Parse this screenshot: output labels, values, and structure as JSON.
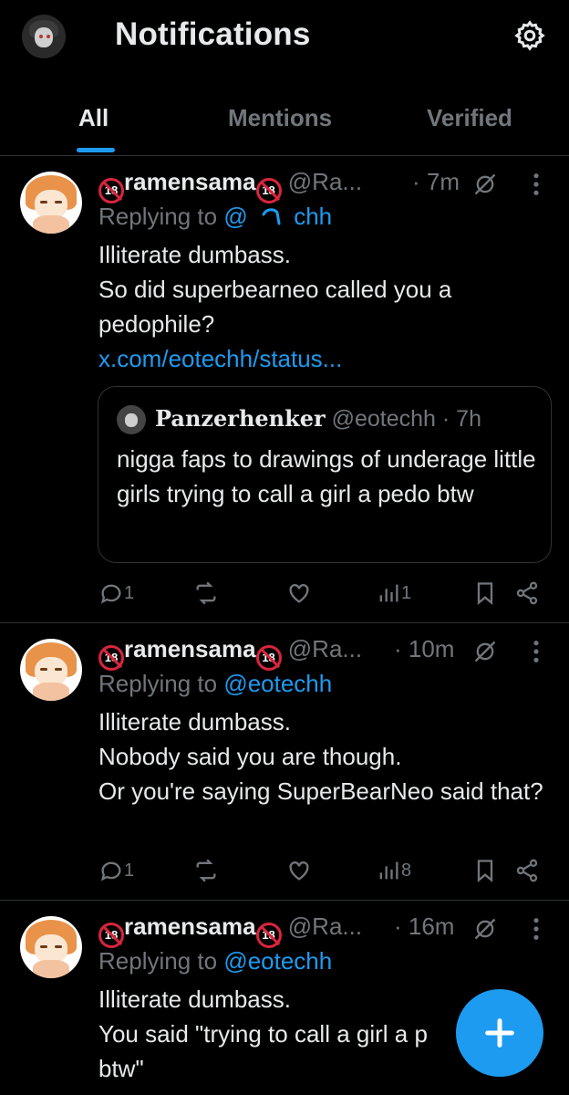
{
  "header": {
    "title": "Notifications"
  },
  "tabs": [
    {
      "label": "All",
      "active": true
    },
    {
      "label": "Mentions",
      "active": false
    },
    {
      "label": "Verified",
      "active": false
    }
  ],
  "badge_text": "18",
  "tweets": [
    {
      "name": "ramensama",
      "handle": "@Ra...",
      "time": "· 7m",
      "reply_prefix": "Replying to",
      "reply_handle_start": "@",
      "reply_handle_end": "chh",
      "body": "Illiterate dumbass.\nSo did superbearneo called you a pedophile?",
      "link": "x.com/eotechh/status...",
      "quote": {
        "name": "Panzerhenker",
        "handle": "@eotechh",
        "time": "· 7h",
        "text": "nigga faps to drawings of underage little girls trying to call a girl a pedo btw"
      },
      "replies": "1",
      "views": "1"
    },
    {
      "name": "ramensama",
      "handle": "@Ra...",
      "time": "· 10m",
      "reply_prefix": "Replying to",
      "reply_handle": "@eotechh",
      "body": "Illiterate dumbass.\nNobody said you are though.\nOr you're saying SuperBearNeo said that?",
      "replies": "1",
      "views": "8"
    },
    {
      "name": "ramensama",
      "handle": "@Ra...",
      "time": "· 16m",
      "reply_prefix": "Replying to",
      "reply_handle": "@eotechh",
      "body": "Illiterate dumbass.\nYou said \"trying to call a girl a p\nbtw\""
    }
  ],
  "colors": {
    "accent": "#1d9bf0",
    "muted": "#71767b",
    "text": "#e7e9ea",
    "border": "#2f3336",
    "badge": "#d9253d"
  }
}
